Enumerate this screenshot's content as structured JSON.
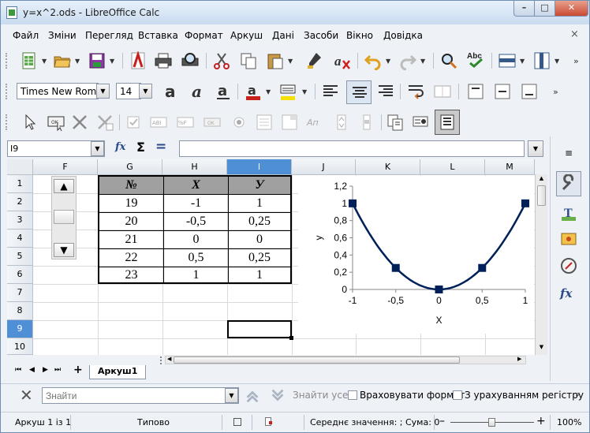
{
  "window": {
    "title": "y=x^2.ods - LibreOffice Calc",
    "minimize": "–",
    "maximize": "□",
    "close": "✕"
  },
  "menu": [
    "Файл",
    "Зміни",
    "Перегляд",
    "Вставка",
    "Формат",
    "Аркуш",
    "Дані",
    "Засоби",
    "Вікно",
    "Довідка"
  ],
  "menu_close": "×",
  "formatting": {
    "font_name": "Times New Roman",
    "font_size": "14"
  },
  "formula_bar": {
    "name_box": "I9",
    "sum_symbol": "Σ",
    "equals_symbol": "=",
    "function_wizard": "fx",
    "content": ""
  },
  "columns": [
    "F",
    "G",
    "H",
    "I",
    "J",
    "K",
    "L",
    "M"
  ],
  "rows": [
    "1",
    "2",
    "3",
    "4",
    "5",
    "6",
    "7",
    "8",
    "9",
    "10"
  ],
  "selected_cell": {
    "column": "I",
    "row": "9"
  },
  "table": {
    "headers": [
      "№",
      "X",
      "У"
    ],
    "rows": [
      [
        "19",
        "-1",
        "1"
      ],
      [
        "20",
        "-0,5",
        "0,25"
      ],
      [
        "21",
        "0",
        "0"
      ],
      [
        "22",
        "0,5",
        "0,25"
      ],
      [
        "23",
        "1",
        "1"
      ]
    ]
  },
  "spinner": {
    "up": "▲",
    "down": "▼"
  },
  "chart_data": {
    "type": "line",
    "x": [
      -1,
      -0.5,
      0,
      0.5,
      1
    ],
    "series": [
      {
        "values": [
          1,
          0.25,
          0,
          0.25,
          1
        ],
        "color": "#00205a",
        "smooth": true,
        "marker": "square"
      }
    ],
    "xlabel": "X",
    "ylabel": "y",
    "xticks": [
      "-1",
      "-0,5",
      "0",
      "0,5",
      "1"
    ],
    "yticks": [
      "0",
      "0,2",
      "0,4",
      "0,6",
      "0,8",
      "1",
      "1,2"
    ],
    "xlim": [
      -1,
      1
    ],
    "ylim": [
      0,
      1.2
    ],
    "grid": false
  },
  "sheet_tabs": {
    "nav": [
      "⏮",
      "◀",
      "▶",
      "⏭"
    ],
    "add": "+",
    "active": "Аркуш1"
  },
  "find_bar": {
    "placeholder": "Знайти",
    "find_all": "Знайти усе",
    "match_format": "Враховувати формат",
    "match_case": "З урахуванням регістру"
  },
  "status_bar": {
    "sheet": "Аркуш 1 із 1",
    "style": "Типово",
    "summary": "Середнє значення: ; Сума: 0",
    "zoom_minus": "–",
    "zoom_plus": "+",
    "zoom": "100%"
  },
  "colors": {
    "accent": "#4e8fd5",
    "table_header": "#a0a0a0",
    "series": "#00205a"
  }
}
